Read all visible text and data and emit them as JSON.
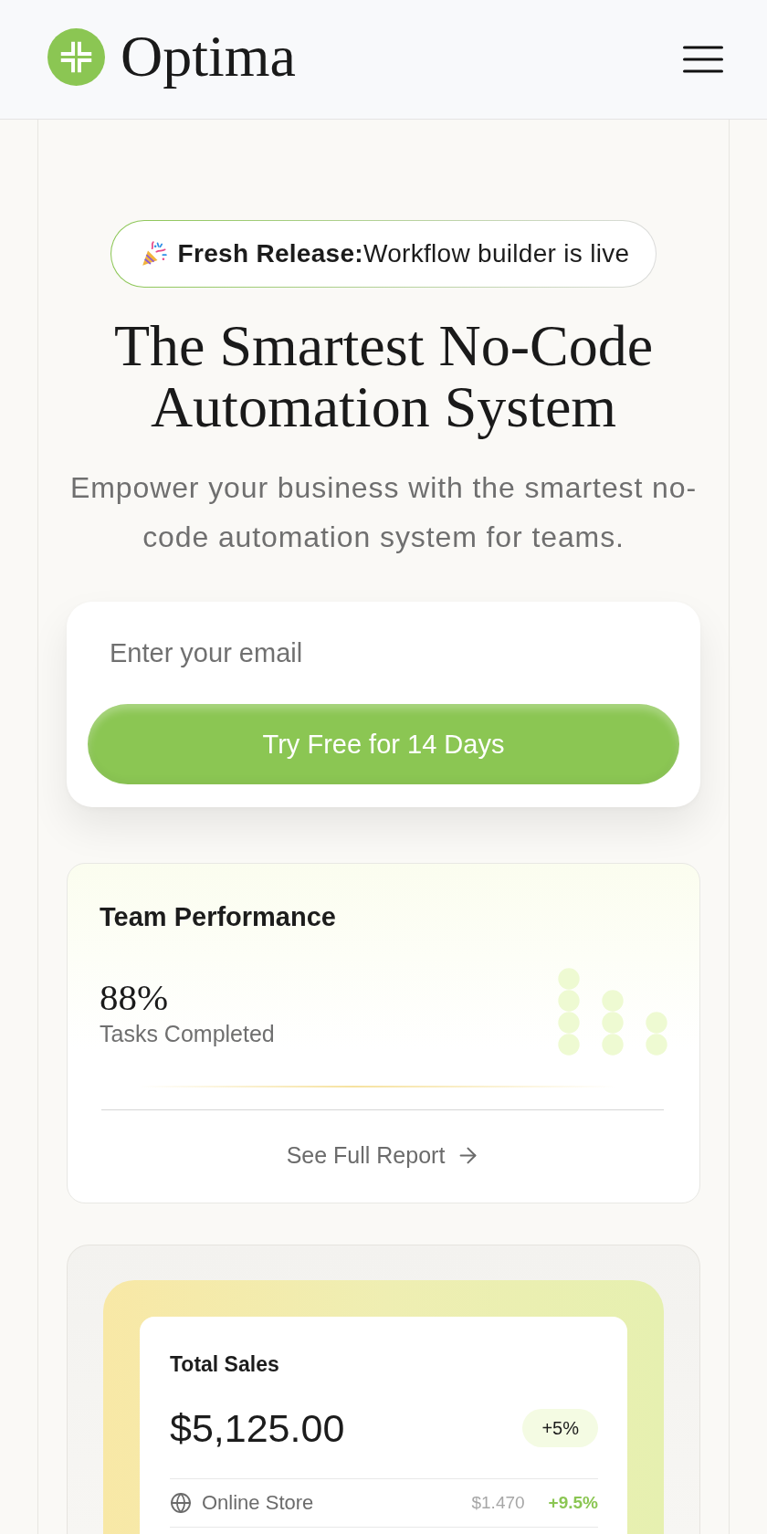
{
  "header": {
    "brand": "Optima"
  },
  "hero": {
    "badge": "**Fresh Release:**Workflow builder is live",
    "title": "The Smartest No-Code Automation System",
    "subtitle": "Empower your business with the smartest no-code automation system for teams."
  },
  "signup": {
    "email": {
      "placeholder": "Enter your email"
    },
    "button": "Try Free for 14 Days"
  },
  "performance": {
    "title": "Team Performance",
    "value": "88%",
    "caption": "Tasks Completed",
    "link": "See Full Report"
  },
  "sales": {
    "title": "Total Sales",
    "amount": "$5,125.00",
    "change": "+5%",
    "channels": [
      {
        "name": "Online Store",
        "amount": "$1.470",
        "change": "+9.5%"
      }
    ]
  }
}
